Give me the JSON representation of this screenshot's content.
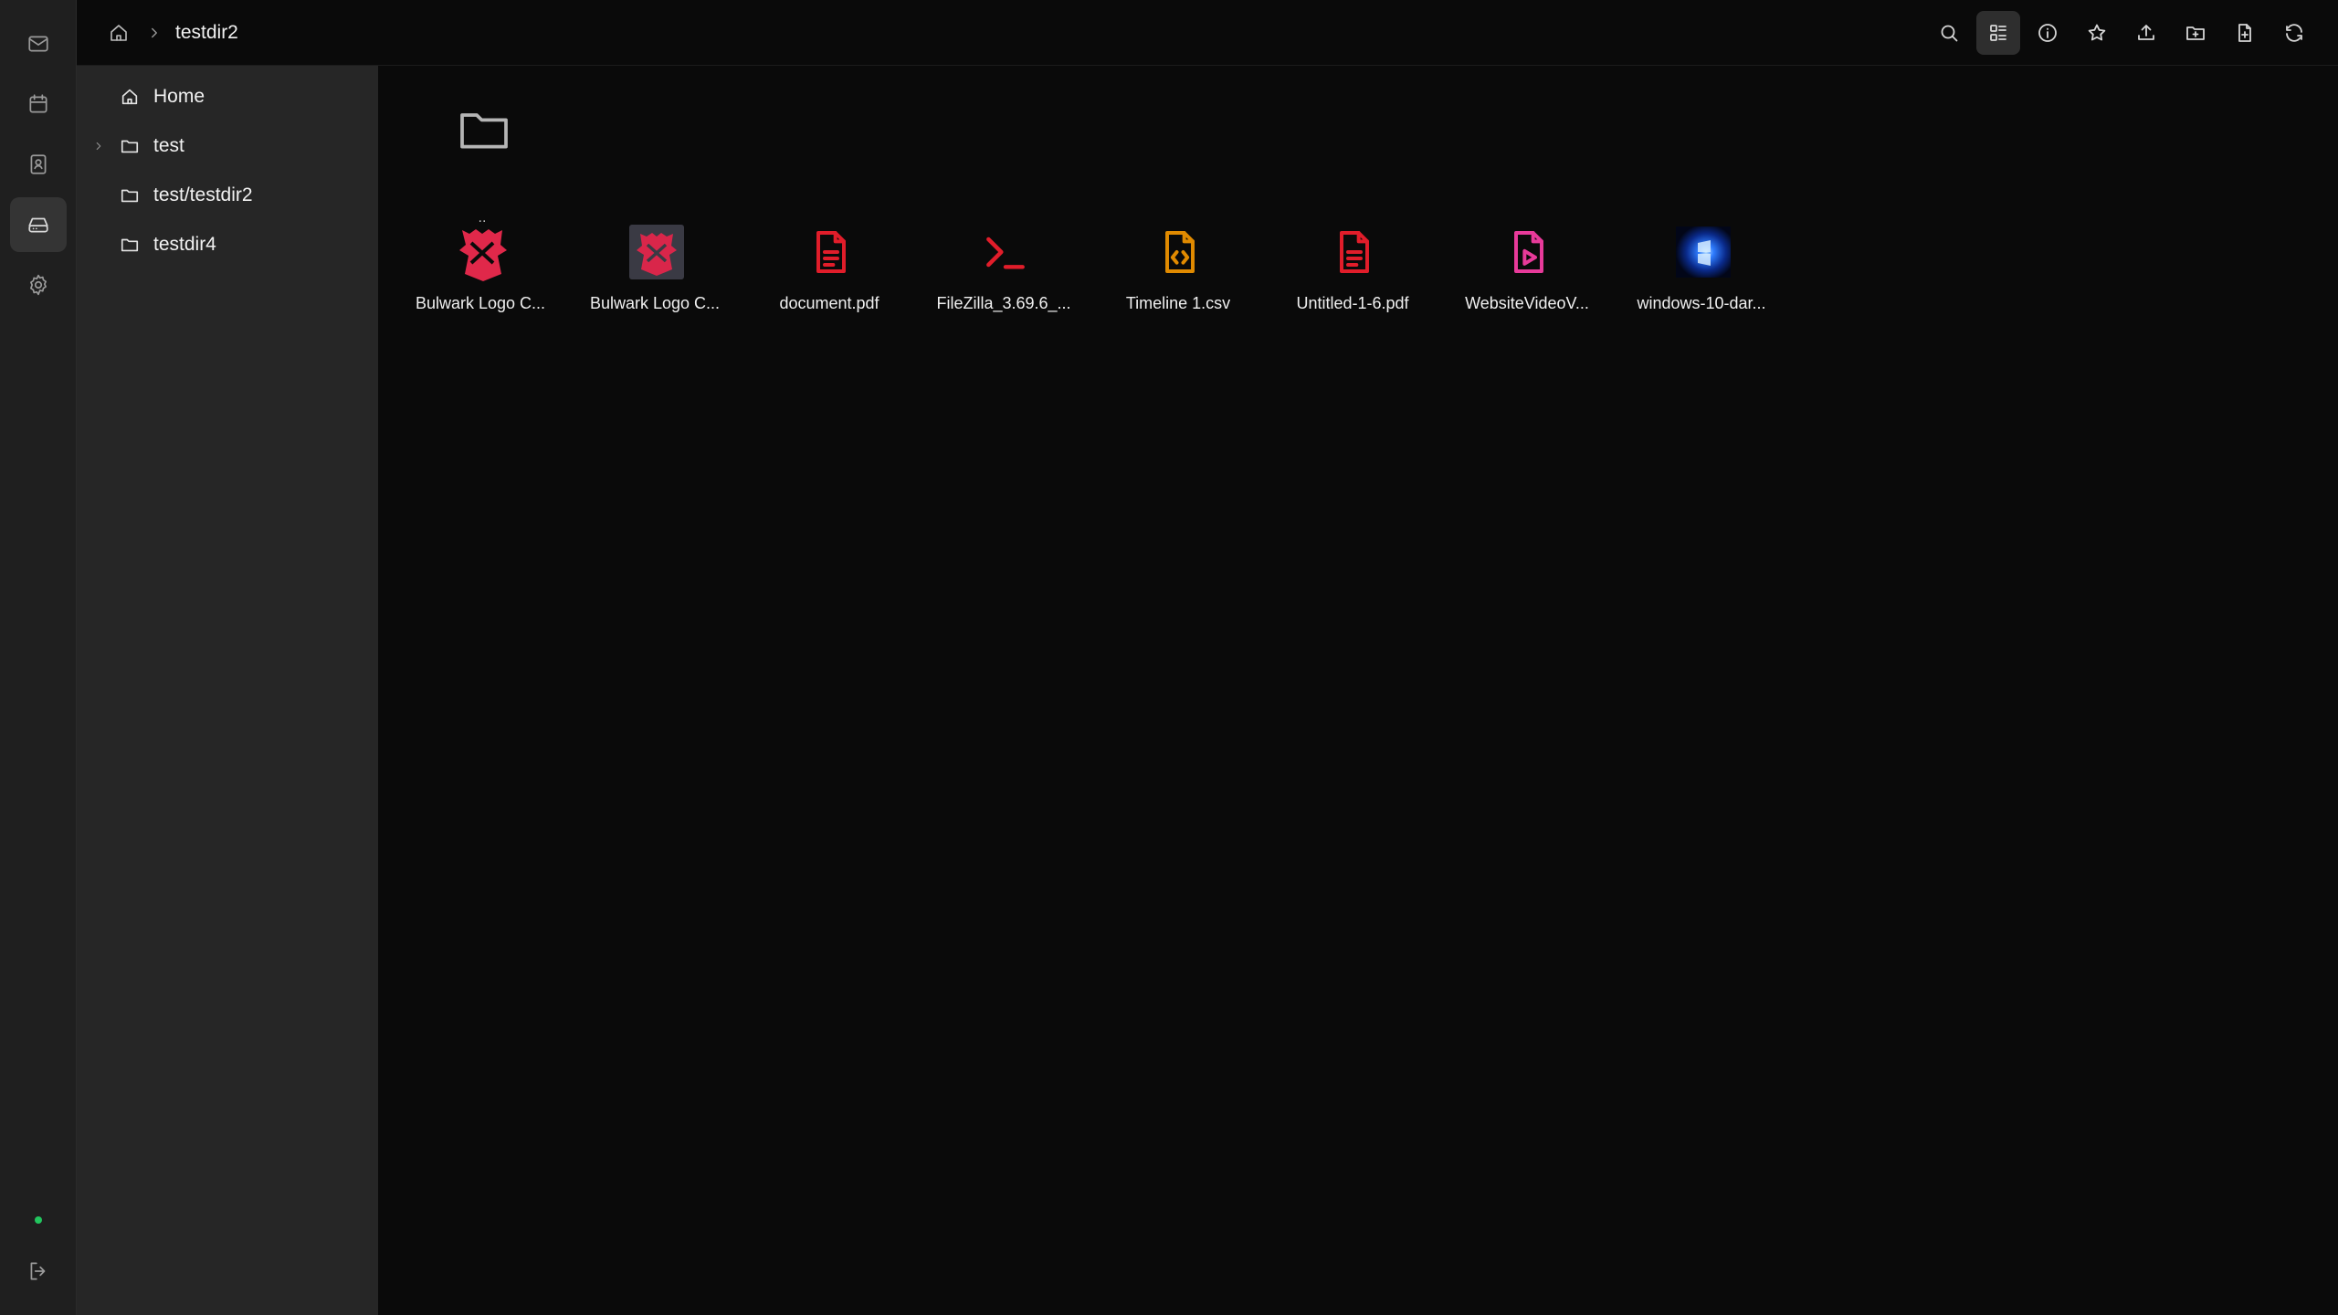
{
  "breadcrumb": {
    "home_icon": "home-icon",
    "current": "testdir2"
  },
  "toolbar": {
    "buttons": [
      "search-icon",
      "grid-view-icon",
      "info-icon",
      "star-icon",
      "upload-icon",
      "new-folder-icon",
      "new-file-icon",
      "refresh-icon"
    ],
    "active": "grid-view-icon"
  },
  "rail": {
    "items": [
      "mail-icon",
      "calendar-icon",
      "contacts-icon",
      "drive-icon",
      "settings-icon"
    ],
    "active": "drive-icon",
    "status_color": "#22c55e",
    "logout_icon": "logout-icon"
  },
  "tree": {
    "items": [
      {
        "label": "Home",
        "icon": "home-icon",
        "expandable": false
      },
      {
        "label": "test",
        "icon": "folder-icon",
        "expandable": true
      },
      {
        "label": "test/testdir2",
        "icon": "folder-icon",
        "expandable": false
      },
      {
        "label": "testdir4",
        "icon": "folder-icon",
        "expandable": false
      }
    ]
  },
  "files": {
    "parent": {
      "label": "..",
      "icon": "folder-icon"
    },
    "items": [
      {
        "name": "Bulwark Logo C...",
        "icon": "bulwark-logo-icon",
        "color": "#e0284a"
      },
      {
        "name": "Bulwark Logo C...",
        "icon": "bulwark-logo-dark-icon",
        "color": "#d9264a"
      },
      {
        "name": "document.pdf",
        "icon": "pdf-file-icon",
        "color": "#e11d2a"
      },
      {
        "name": "FileZilla_3.69.6_...",
        "icon": "executable-terminal-icon",
        "color": "#e11d2a"
      },
      {
        "name": "Timeline 1.csv",
        "icon": "code-file-icon",
        "color": "#e08a00"
      },
      {
        "name": "Untitled-1-6.pdf",
        "icon": "pdf-file-icon",
        "color": "#e11d2a"
      },
      {
        "name": "WebsiteVideoV...",
        "icon": "video-file-icon",
        "color": "#e83a9a"
      },
      {
        "name": "windows-10-dar...",
        "icon": "image-thumbnail-icon",
        "color": "#1e6fff"
      }
    ]
  }
}
